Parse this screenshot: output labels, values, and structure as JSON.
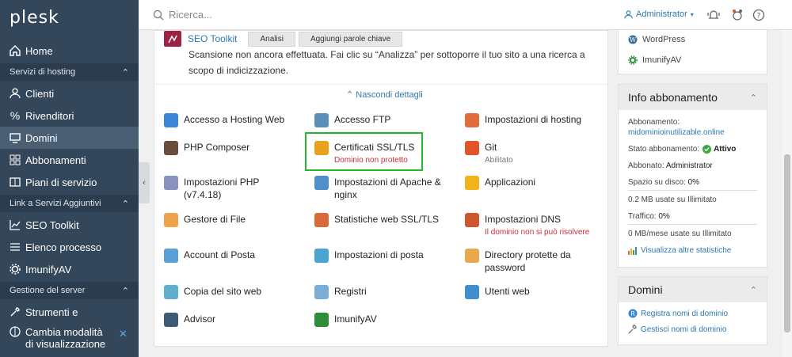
{
  "logo": "plesk",
  "sidebar": {
    "home": "Home",
    "sec_hosting": "Servizi di hosting",
    "clienti": "Clienti",
    "rivenditori": "Rivenditori",
    "domini": "Domini",
    "abbonamenti": "Abbonamenti",
    "piani": "Piani di servizio",
    "sec_links": "Link a Servizi Aggiuntivi",
    "seo": "SEO Toolkit",
    "elenco": "Elenco processo",
    "imunify": "ImunifyAV",
    "sec_server": "Gestione del server",
    "strumenti": "Strumenti e",
    "cambia": "Cambia modalità di visualizzazione"
  },
  "topbar": {
    "search_placeholder": "Ricerca...",
    "admin": "Administrator"
  },
  "seo": {
    "title": "SEO Toolkit",
    "btn_analisi": "Analisi",
    "btn_parole": "Aggiungi parole chiave",
    "text": "Scansione non ancora effettuata. Fai clic su “Analizza” per sottoporre il tuo sito a una ricerca a scopo di indicizzazione."
  },
  "hide_details": "Nascondi dettagli",
  "tools": [
    {
      "label": "Accesso a Hosting Web",
      "color": "#3b86d6"
    },
    {
      "label": "Accesso FTP",
      "color": "#5b8fb9"
    },
    {
      "label": "Impostazioni di hosting",
      "color": "#e06d3a"
    },
    {
      "label": "PHP Composer",
      "color": "#6b4b3a"
    },
    {
      "label": "Certificati SSL/TLS",
      "sub": "Dominio non protetto",
      "color": "#e9a21c"
    },
    {
      "label": "Git",
      "sub": "Abilitato",
      "color": "#e2552a"
    },
    {
      "label": "Impostazioni PHP (v7.4.18)",
      "color": "#8892c1"
    },
    {
      "label": "Impostazioni di Apache & nginx",
      "color": "#4f8fca"
    },
    {
      "label": "Applicazioni",
      "color": "#f2b21b"
    },
    {
      "label": "Gestore di File",
      "color": "#f0a24a"
    },
    {
      "label": "Statistiche web SSL/TLS",
      "color": "#d96b3b"
    },
    {
      "label": "Impostazioni DNS",
      "sub": "Il dominio non si può risolvere",
      "color": "#d0542d"
    },
    {
      "label": "Account di Posta",
      "color": "#5aa0d8"
    },
    {
      "label": "Impostazioni di posta",
      "color": "#4ba4d1"
    },
    {
      "label": "Directory protette da password",
      "color": "#e7a84e"
    },
    {
      "label": "Copia del sito web",
      "color": "#5fb0d0"
    },
    {
      "label": "Registri",
      "color": "#7aaed6"
    },
    {
      "label": "Utenti web",
      "color": "#3f8ed0"
    },
    {
      "label": "Advisor",
      "color": "#3b5a78"
    },
    {
      "label": "ImunifyAV",
      "color": "#2f8e3a"
    }
  ],
  "right": {
    "wordpress": "WordPress",
    "imunify": "ImunifyAV",
    "info_title": "Info abbonamento",
    "abbonamento_label": "Abbonamento:",
    "abbonamento_val": "midominioinutilizable.online",
    "stato_label": "Stato abbonamento:",
    "stato_val": "Attivo",
    "abbonato_label": "Abbonato:",
    "abbonato_val": "Administrator",
    "spazio_label": "Spazio su disco:",
    "spazio_val": "0%",
    "spazio_detail": "0.2 MB usate su Illimitato",
    "traffico_label": "Traffico:",
    "traffico_val": "0%",
    "traffico_detail": "0 MB/mese usate su Illimitato",
    "stats_link": "Visualizza altre statistiche",
    "domini_title": "Domini",
    "registra": "Registra nomi di dominio",
    "gestisci": "Gestisci nomi di dominio"
  }
}
